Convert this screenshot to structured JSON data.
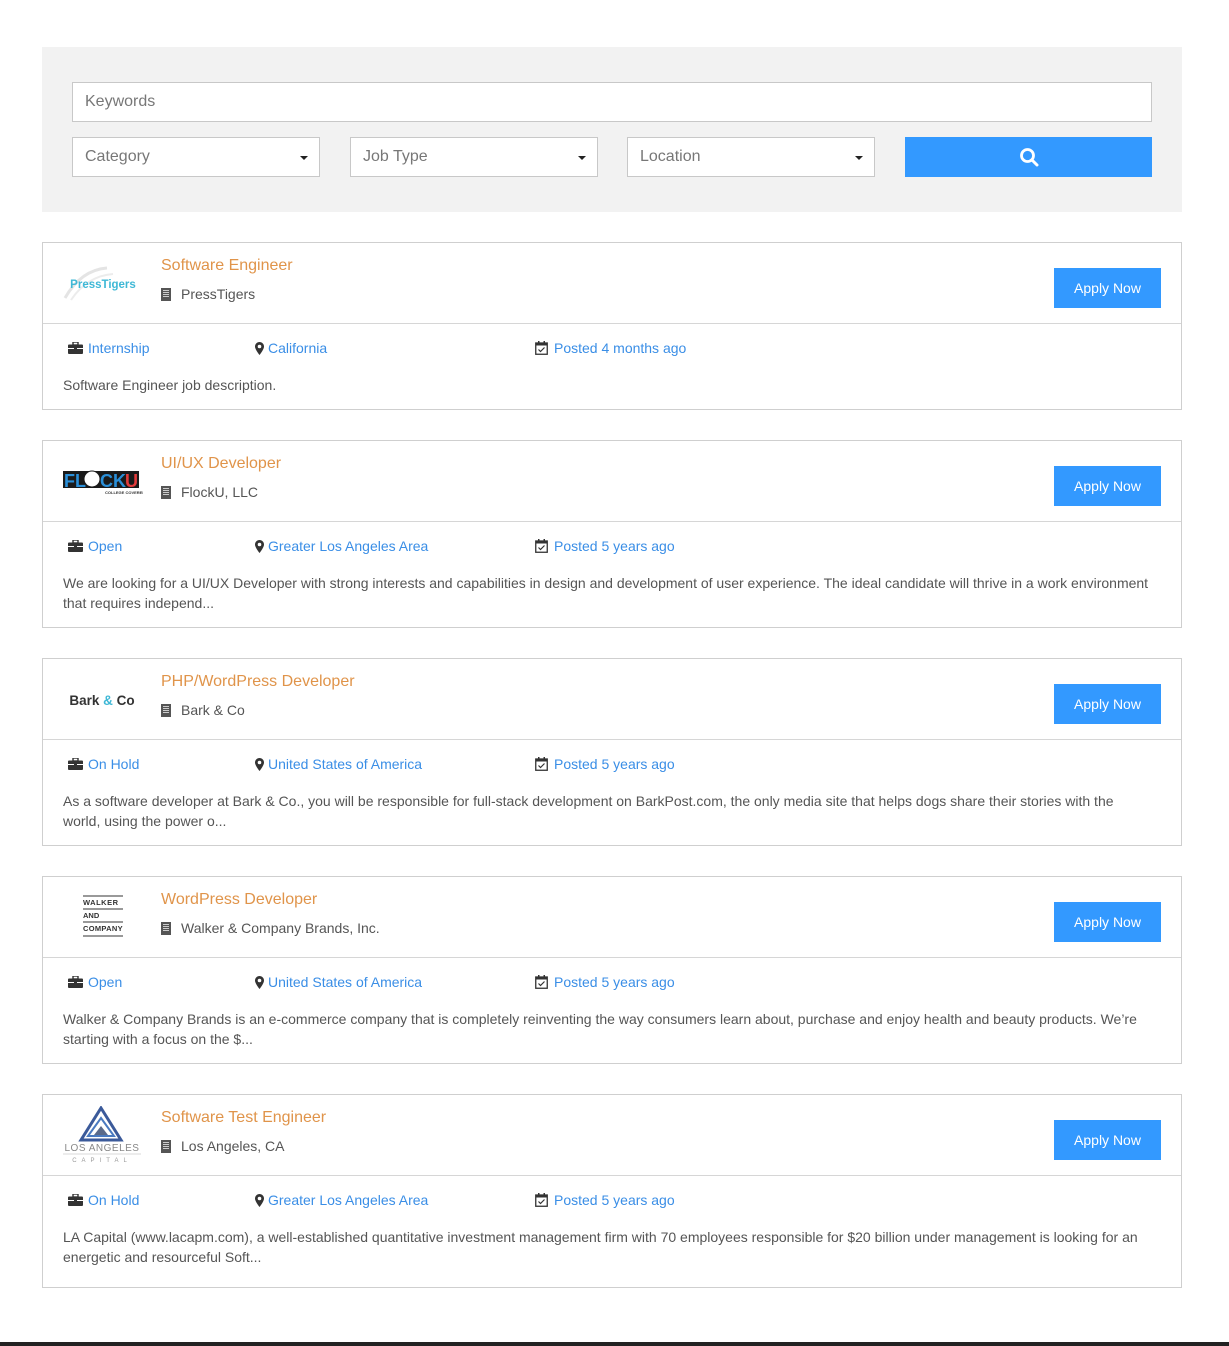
{
  "search": {
    "keywords_placeholder": "Keywords",
    "category_label": "Category",
    "job_type_label": "Job Type",
    "location_label": "Location",
    "search_button_icon": "search-icon"
  },
  "colors": {
    "accent": "#3399ff",
    "title": "#e0944a",
    "meta_link": "#3a8ee6",
    "panel_bg": "#f2f2f2"
  },
  "jobs": [
    {
      "title": "Software Engineer",
      "company": "PressTigers",
      "logo_text": "PressTigers",
      "apply_label": "Apply Now",
      "job_type": "Internship",
      "location": "California",
      "posted": "Posted 4 months ago",
      "description": "Software Engineer job description."
    },
    {
      "title": "UI/UX Developer",
      "company": "FlockU, LLC",
      "logo_text": "FLOCKU",
      "apply_label": "Apply Now",
      "job_type": "Open",
      "location": "Greater Los Angeles Area",
      "posted": "Posted 5 years ago",
      "description": "We are looking for a UI/UX Developer with strong interests and capabilities in design and development of user experience.  The ideal candidate will thrive in a work environment that requires independ..."
    },
    {
      "title": "PHP/WordPress Developer",
      "company": "Bark & Co",
      "logo_text": "Bark & Co",
      "apply_label": "Apply Now",
      "job_type": "On Hold",
      "location": "United States of America",
      "posted": "Posted 5 years ago",
      "description": "As a software developer at Bark & Co., you will be responsible for full-stack development on BarkPost.com, the only media site that helps dogs share their stories with the world, using the power o..."
    },
    {
      "title": "WordPress Developer",
      "company": "Walker & Company Brands, Inc.",
      "logo_text": "WALKER AND COMPANY",
      "apply_label": "Apply Now",
      "job_type": "Open",
      "location": "United States of America",
      "posted": "Posted 5 years ago",
      "description": "Walker & Company Brands is an e-commerce company that is completely reinventing the way consumers learn about, purchase and enjoy health and beauty products. We’re starting with a focus on the $..."
    },
    {
      "title": "Software Test Engineer",
      "company": "Los Angeles, CA",
      "logo_text": "LOS ANGELES CAPITAL",
      "apply_label": "Apply Now",
      "job_type": "On Hold",
      "location": "Greater Los Angeles Area",
      "posted": "Posted 5 years ago",
      "description": "LA Capital (www.lacapm.com), a well-established quantitative investment management firm with 70 employees responsible for $20 billion under management is looking for an energetic and resourceful Soft..."
    }
  ]
}
